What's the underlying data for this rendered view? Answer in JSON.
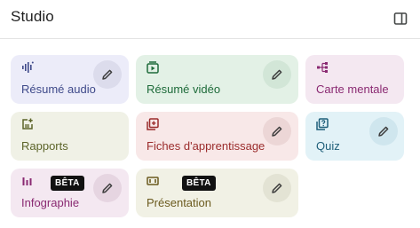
{
  "panel": {
    "title": "Studio",
    "toggle_icon": "side-panel-icon"
  },
  "colors": {
    "audio_bg": "#ececf9",
    "audio_fg": "#3f4a8a",
    "video_bg": "#e3f1e6",
    "video_fg": "#1e6b3a",
    "mindmap_bg": "#f4e8f1",
    "mindmap_fg": "#8a2a72",
    "reports_bg": "#f0f1e6",
    "reports_fg": "#5c6429",
    "flashcards_bg": "#f8e8e8",
    "flashcards_fg": "#9b2c2c",
    "quiz_bg": "#e2f2f7",
    "quiz_fg": "#1f5f7a",
    "infographic_bg": "#f4e8f1",
    "infographic_fg": "#8a2a72",
    "presentation_bg": "#f1f1e5",
    "presentation_fg": "#6b5a1e",
    "badge_bg": "#111111",
    "badge_fg": "#ffffff"
  },
  "cards": [
    {
      "id": "audio",
      "label": "Résumé audio",
      "icon": "audio-waveform-icon",
      "editable": true
    },
    {
      "id": "video",
      "label": "Résumé vidéo",
      "icon": "video-play-icon",
      "editable": true
    },
    {
      "id": "mindmap",
      "label": "Carte mentale",
      "icon": "mind-map-icon",
      "editable": false
    },
    {
      "id": "reports",
      "label": "Rapports",
      "icon": "report-add-icon",
      "editable": false
    },
    {
      "id": "flashcards",
      "label": "Fiches d'apprentissage",
      "icon": "flashcards-icon",
      "editable": true
    },
    {
      "id": "quiz",
      "label": "Quiz",
      "icon": "quiz-icon",
      "editable": true
    },
    {
      "id": "infographic",
      "label": "Infographie",
      "icon": "bar-chart-icon",
      "badge": "BÊTA",
      "editable": true
    },
    {
      "id": "presentation",
      "label": "Présentation",
      "icon": "slides-icon",
      "badge": "BÊTA",
      "editable": true
    }
  ]
}
